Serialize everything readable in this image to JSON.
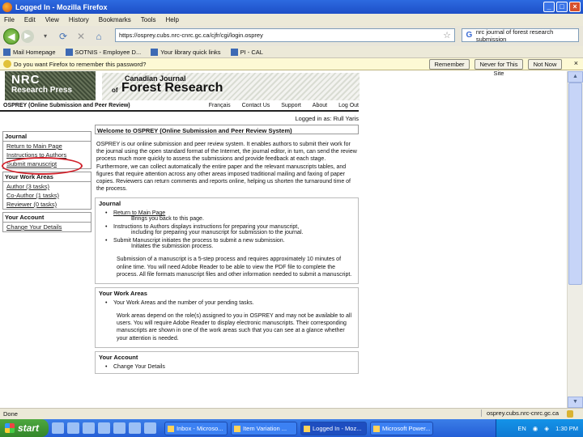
{
  "window": {
    "title": "Logged In - Mozilla Firefox"
  },
  "menu": [
    "File",
    "Edit",
    "View",
    "History",
    "Bookmarks",
    "Tools",
    "Help"
  ],
  "nav": {
    "url": "https://osprey.cubs.nrc-cnrc.gc.ca/cjfr/cgi/login.osprey",
    "search": "nrc journal of forest research submission"
  },
  "bookmarks": [
    "Mail Homepage",
    "SOTNIS - Employee D...",
    "Your library quick links",
    "PI - CAL"
  ],
  "notification": {
    "text": "Do you want Firefox to remember this password?",
    "remember": "Remember",
    "never": "Never for This Site",
    "notnow": "Not Now"
  },
  "banner": {
    "nrc": "NRC",
    "research_press": "Research Press",
    "canadian_journal": "Canadian Journal",
    "of": "of",
    "forest_research": "Forest Research"
  },
  "sitenav": {
    "brand": "OSPREY (Online Submission and Peer Review)",
    "links": [
      "Français",
      "Contact Us",
      "Support",
      "About",
      "Log Out"
    ]
  },
  "logged_in": "Logged in as: Rull Yaris",
  "leftnav": {
    "journal_head": "Journal",
    "journal_links": [
      "Return to Main Page",
      "Instructions to Authors",
      "Submit manuscript"
    ],
    "work_head": "Your Work Areas",
    "work_links": [
      "Author (3 tasks)",
      "Co-Author (1 tasks)",
      "Reviewer (0 tasks)"
    ],
    "account_head": "Your Account",
    "account_links": [
      "Change Your Details"
    ]
  },
  "main": {
    "welcome": "Welcome to OSPREY (Online Submission and Peer Review System)",
    "intro": "OSPREY is our online submission and peer review system. It enables authors to submit their work for the journal using the open standard format of the Internet, the journal editor, in turn, can send the review process much more quickly to assess the submissions and provide feedback at each stage. Furthermore, we can collect automatically the entire paper and the relevant manuscripts tables, and figures that require attention across any other areas imposed traditional mailing and faxing of paper copies. Reviewers can return comments and reports online, helping us shorten the turnaround time of the process.",
    "journal_section": {
      "head": "Journal",
      "items": [
        {
          "title": "Return to Main Page",
          "desc": "Brings you back to this page."
        },
        {
          "title": "Instructions to Authors displays instructions for preparing your manuscript,",
          "desc": "including for preparing your manuscript for submission to the journal."
        },
        {
          "title": "Submit Manuscript initiates the process to submit a new submission.",
          "desc": "Initiates the submission process."
        }
      ],
      "para": "Submission of a manuscript is a 5-step process and requires approximately 10 minutes of online time. You will need Adobe Reader to be able to view the PDF file to complete the process. All file formats manuscript files and other information needed to submit a manuscript."
    },
    "work_section": {
      "head": "Your Work Areas",
      "items": [
        {
          "title": "Your Work Areas and the number of your pending tasks."
        }
      ],
      "para": "Work areas depend on the role(s) assigned to you in OSPREY and may not be available to all users. You will require Adobe Reader to display electronic manuscripts. Their corresponding manuscripts are shown in one of the work areas such that you can see at a glance whether your attention is needed."
    },
    "account_section": {
      "head": "Your Account",
      "items": [
        {
          "title": "Change Your Details"
        }
      ]
    }
  },
  "status": {
    "left": "Done",
    "right": "osprey.cubs.nrc-cnrc.gc.ca"
  },
  "taskbar": {
    "start": "start",
    "tasks": [
      "Inbox - Microso...",
      "Item Variation ...",
      "Logged In - Moz...",
      "Microsoft Power..."
    ],
    "lang": "EN",
    "clock": "1:30 PM"
  }
}
